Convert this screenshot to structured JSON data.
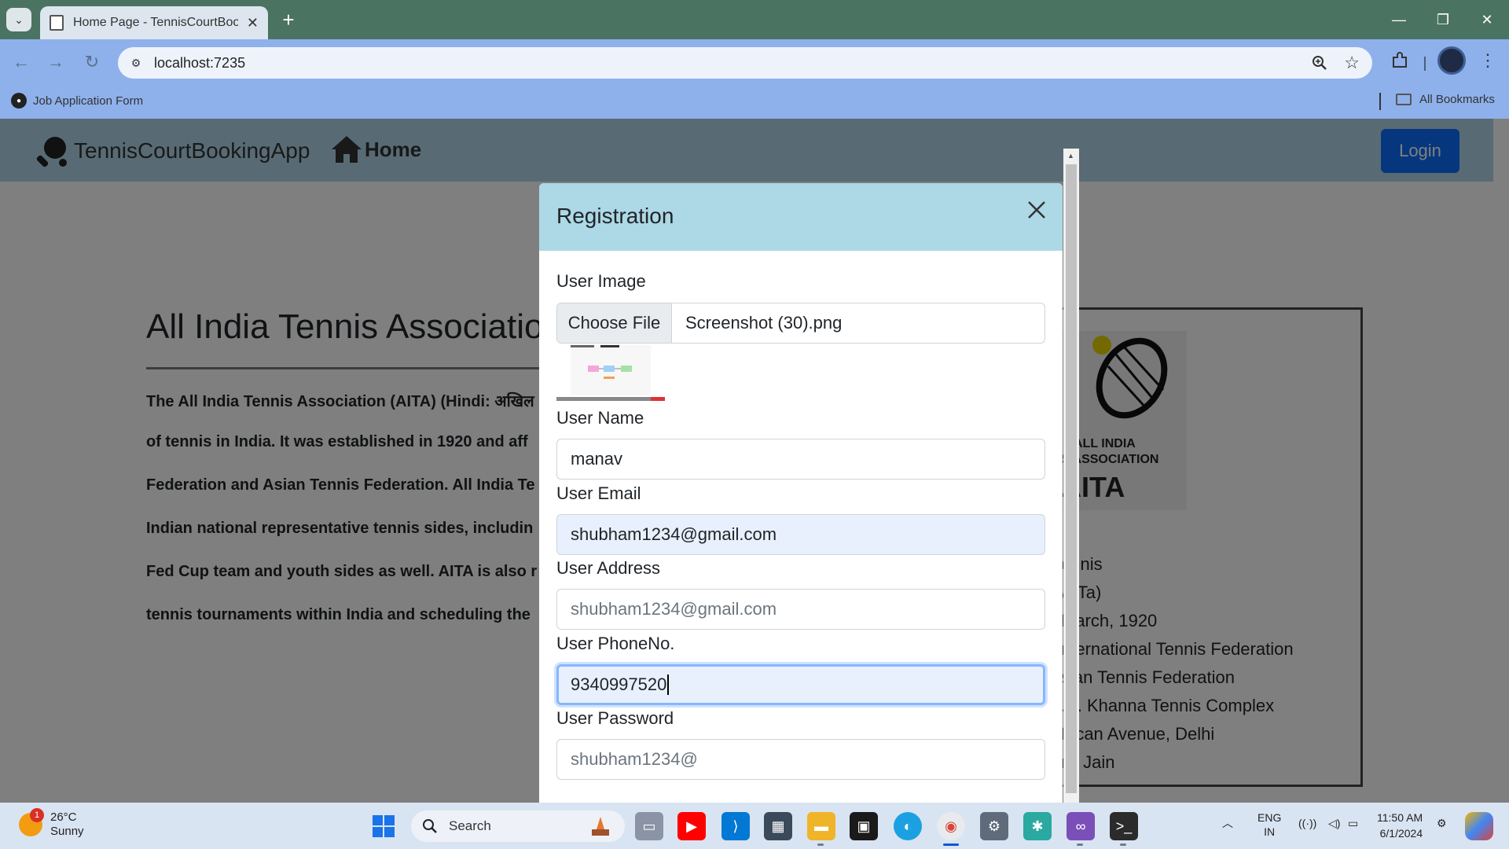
{
  "browser": {
    "tab_title": "Home Page - TennisCourtBookingApp",
    "url": "localhost:7235",
    "bookmark": "Job Application Form",
    "all_bookmarks": "All Bookmarks"
  },
  "app": {
    "brand": "TennisCourtBookingApp",
    "home": "Home",
    "login": "Login"
  },
  "content": {
    "title": "All India Tennis Association",
    "paragraph_lines": [
      "The All India Tennis Association (AITA) (Hindi: अखिल",
      "of tennis in India. It was established in 1920 and aff",
      "Federation and Asian Tennis Federation. All India Te",
      "Indian national representative tennis sides, includin",
      "Fed Cup team and youth sides as well. AITA is also r",
      "tennis tournaments within India and scheduling the"
    ],
    "logo_text": {
      "line1": "ALL INDIA",
      "line2": "S ASSOCIATION",
      "line3": "AITA"
    },
    "info_lines": [
      "ennis",
      "AITa)",
      "March, 1920",
      "nternational Tennis Federation",
      "sian Tennis Federation",
      ".K. Khanna Tennis Complex",
      "frican Avenue, Delhi",
      "nil Jain"
    ]
  },
  "modal": {
    "title": "Registration",
    "image_label": "User Image",
    "choose_file": "Choose File",
    "file_name": "Screenshot (30).png",
    "name_label": "User Name",
    "name_value": "manav",
    "email_label": "User Email",
    "email_value": "shubham1234@gmail.com",
    "address_label": "User Address",
    "address_placeholder": "shubham1234@gmail.com",
    "phone_label": "User PhoneNo.",
    "phone_value": "9340997520",
    "password_label": "User Password",
    "password_placeholder": "shubham1234@"
  },
  "taskbar": {
    "weather_badge": "1",
    "temperature": "26°C",
    "condition": "Sunny",
    "search": "Search",
    "lang1": "ENG",
    "lang2": "IN",
    "time": "11:50 AM",
    "date": "6/1/2024"
  },
  "colors": {
    "browser_tabbar": "#4b7361",
    "browser_toolbar": "#8eb1ec",
    "navbar": "#b0d6ea",
    "modal_header": "#add8e6",
    "login_button": "#0d6efd"
  }
}
